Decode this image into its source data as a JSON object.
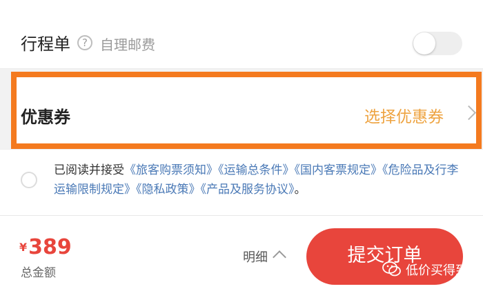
{
  "itinerary": {
    "title": "行程单",
    "help_glyph": "?",
    "note": "自理邮费",
    "toggle_on": false
  },
  "coupon": {
    "title": "优惠券",
    "action": "选择优惠券",
    "highlight_color": "#f47a1f",
    "action_color": "#eea340"
  },
  "agreement": {
    "prefix": "已阅读并接受",
    "links": [
      "《旅客购票须知》",
      "《运输总条件》",
      "《国内客票规定》",
      "《危险品及行李运输限制规定》",
      "《隐私政策》",
      "《产品及服务协议》"
    ],
    "suffix": "。",
    "checked": false
  },
  "footer": {
    "currency": "¥",
    "price": "389",
    "total_label": "总金额",
    "detail_label": "明细",
    "submit_label": "提交订单",
    "accent_color": "#e8453c"
  },
  "watermark": {
    "icon": "wechat-icon",
    "text": "低价买得到"
  }
}
